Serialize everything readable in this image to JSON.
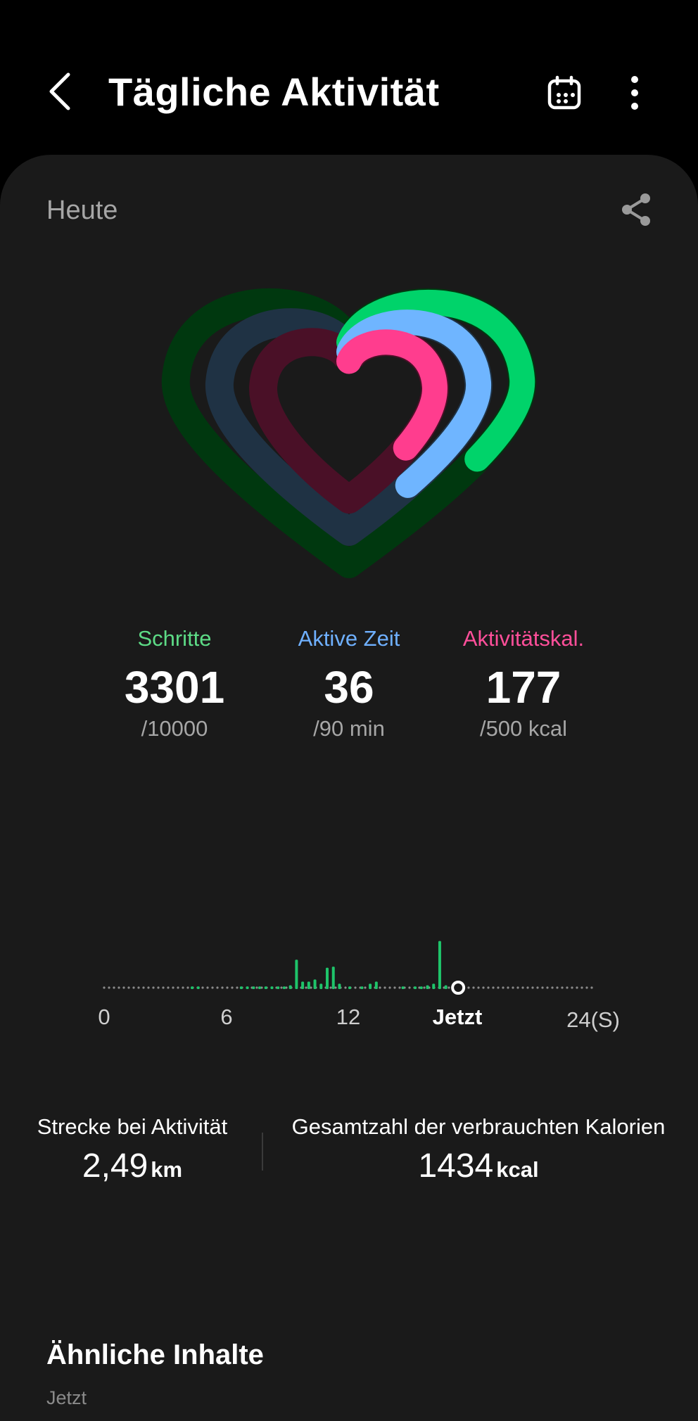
{
  "header": {
    "title": "Tägliche Aktivität",
    "back_icon": "chevron-left-icon",
    "calendar_icon": "calendar-icon",
    "more_icon": "more-vertical-icon"
  },
  "card": {
    "date_label": "Heute",
    "share_icon": "share-icon"
  },
  "rings": {
    "steps_color": "#00d36a",
    "active_time_color": "#6fb5ff",
    "calories_color": "#ff3d8e",
    "steps_progress": 0.33,
    "active_time_progress": 0.4,
    "calories_progress": 0.354
  },
  "stats": [
    {
      "label": "Schritte",
      "value": "3301",
      "goal": "/10000",
      "color": "#5ddb86"
    },
    {
      "label": "Aktive Zeit",
      "value": "36",
      "goal": "/90 min",
      "color": "#6fb0ff"
    },
    {
      "label": "Aktivitätskal.",
      "value": "177",
      "goal": "/500 kcal",
      "color": "#ff4f9a"
    }
  ],
  "timeline": {
    "axis_labels": [
      "0",
      "6",
      "12",
      "Jetzt",
      "24(S)"
    ],
    "now_hour": 17.3,
    "bar_color": "#1ec46a",
    "activity": [
      {
        "h": 4.3,
        "v": 0.05
      },
      {
        "h": 4.6,
        "v": 0.05
      },
      {
        "h": 6.7,
        "v": 0.05
      },
      {
        "h": 7.0,
        "v": 0.05
      },
      {
        "h": 7.3,
        "v": 0.05
      },
      {
        "h": 7.6,
        "v": 0.05
      },
      {
        "h": 7.9,
        "v": 0.05
      },
      {
        "h": 8.2,
        "v": 0.05
      },
      {
        "h": 8.5,
        "v": 0.05
      },
      {
        "h": 8.8,
        "v": 0.05
      },
      {
        "h": 9.1,
        "v": 0.07
      },
      {
        "h": 9.4,
        "v": 0.55
      },
      {
        "h": 9.7,
        "v": 0.14
      },
      {
        "h": 10.0,
        "v": 0.14
      },
      {
        "h": 10.3,
        "v": 0.18
      },
      {
        "h": 10.6,
        "v": 0.1
      },
      {
        "h": 10.9,
        "v": 0.4
      },
      {
        "h": 11.2,
        "v": 0.42
      },
      {
        "h": 11.5,
        "v": 0.1
      },
      {
        "h": 12.0,
        "v": 0.05
      },
      {
        "h": 12.6,
        "v": 0.05
      },
      {
        "h": 13.0,
        "v": 0.1
      },
      {
        "h": 13.3,
        "v": 0.14
      },
      {
        "h": 14.6,
        "v": 0.05
      },
      {
        "h": 15.2,
        "v": 0.05
      },
      {
        "h": 15.5,
        "v": 0.05
      },
      {
        "h": 15.8,
        "v": 0.07
      },
      {
        "h": 16.1,
        "v": 0.1
      },
      {
        "h": 16.4,
        "v": 0.9
      },
      {
        "h": 16.7,
        "v": 0.07
      }
    ]
  },
  "summary": {
    "distance_label": "Strecke bei Aktivität",
    "distance_value": "2,49",
    "distance_unit": "km",
    "calories_label": "Gesamtzahl der verbrauchten Kalorien",
    "calories_value": "1434",
    "calories_unit": "kcal"
  },
  "related": {
    "title": "Ähnliche Inhalte",
    "subtitle": "Jetzt"
  }
}
